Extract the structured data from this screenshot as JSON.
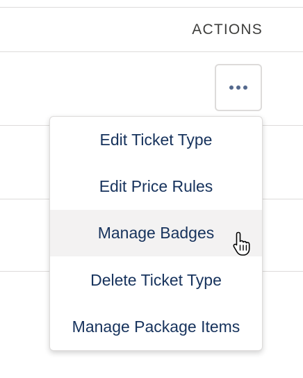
{
  "table": {
    "actions_header": "ACTIONS"
  },
  "row_actions": {
    "more_icon": "more-horizontal-icon",
    "menu": {
      "items": [
        {
          "label": "Edit Ticket Type"
        },
        {
          "label": "Edit Price Rules"
        },
        {
          "label": "Manage Badges",
          "hovered": true
        },
        {
          "label": "Delete Ticket Type"
        },
        {
          "label": "Manage Package Items"
        }
      ]
    }
  },
  "cursor": {
    "icon": "hand-pointer-cursor-icon"
  },
  "colors": {
    "menu_text": "#16325c",
    "hover_background": "#f3f2f2",
    "border": "#dddbda",
    "header_text": "#3e3e3c",
    "dots": "#54698d"
  }
}
